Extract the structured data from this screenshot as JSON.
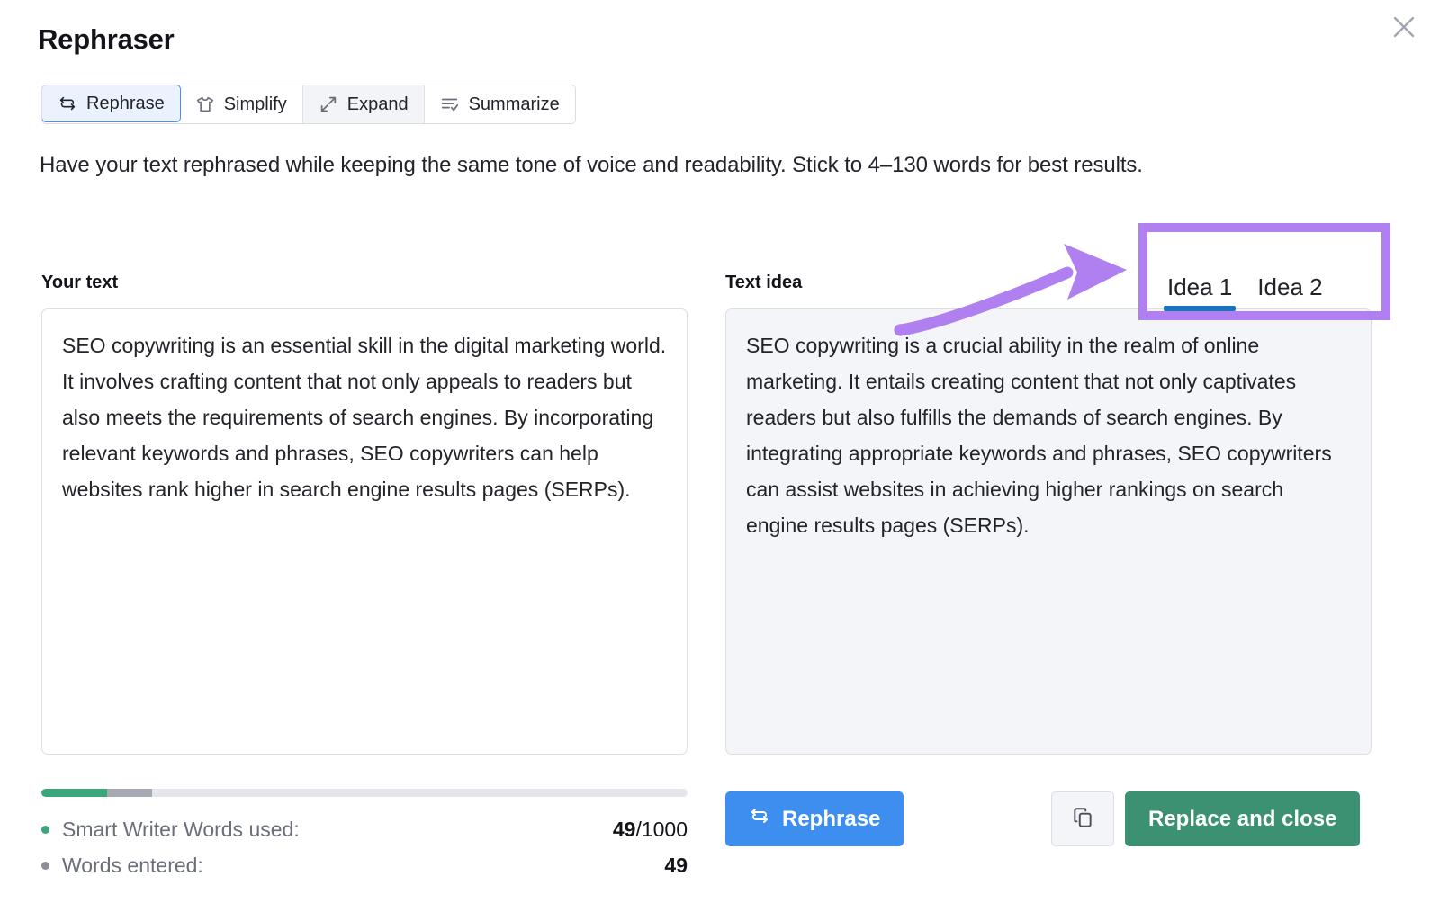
{
  "dialog": {
    "title": "Rephraser",
    "close_icon": "close-icon",
    "description": "Have your text rephrased while keeping the same tone of voice and readability. Stick to 4–130 words for best results."
  },
  "modes": [
    {
      "label": "Rephrase",
      "icon": "rephrase-icon",
      "active": true,
      "shaded": false
    },
    {
      "label": "Simplify",
      "icon": "tshirt-icon",
      "active": false,
      "shaded": false
    },
    {
      "label": "Expand",
      "icon": "expand-icon",
      "active": false,
      "shaded": true
    },
    {
      "label": "Summarize",
      "icon": "summarize-icon",
      "active": false,
      "shaded": false
    }
  ],
  "left_panel": {
    "label": "Your text",
    "value": "SEO copywriting is an essential skill in the digital marketing world. It involves crafting content that not only appeals to readers but also meets the requirements of search engines. By incorporating relevant keywords and phrases, SEO copywriters can help websites rank higher in search engine results pages (SERPs)."
  },
  "right_panel": {
    "label": "Text idea",
    "value": "SEO copywriting is a crucial ability in the realm of online marketing. It entails creating content that not only captivates readers but also fulfills the demands of search engines. By integrating appropriate keywords and phrases, SEO copywriters can assist websites in achieving higher rankings on search engine results pages (SERPs)."
  },
  "idea_tabs": [
    {
      "label": "Idea 1",
      "active": true
    },
    {
      "label": "Idea 2",
      "active": false
    }
  ],
  "annotation": {
    "color": "#b07ff0",
    "shape": "curved-arrow-pointing-right",
    "target": "idea-tabs"
  },
  "usage": {
    "progress": {
      "green_pct": 10.2,
      "gray_pct": 7.0,
      "track_color": "#e4e6ec",
      "green_color": "#3aa77a",
      "gray_color": "#a6a9b2"
    },
    "rows": [
      {
        "label": "Smart Writer Words used:",
        "value_bold": "49",
        "value_rest": "/1000",
        "bullet_color": "#3aa77a"
      },
      {
        "label": "Words entered:",
        "value_bold": "49",
        "value_rest": "",
        "bullet_color": "#8b8f99"
      }
    ]
  },
  "actions": {
    "rephrase_label": "Rephrase",
    "rephrase_icon": "rephrase-icon",
    "rephrase_color": "#3e8ef0",
    "copy_icon": "copy-icon",
    "replace_label": "Replace and close",
    "replace_color": "#3b9171"
  }
}
